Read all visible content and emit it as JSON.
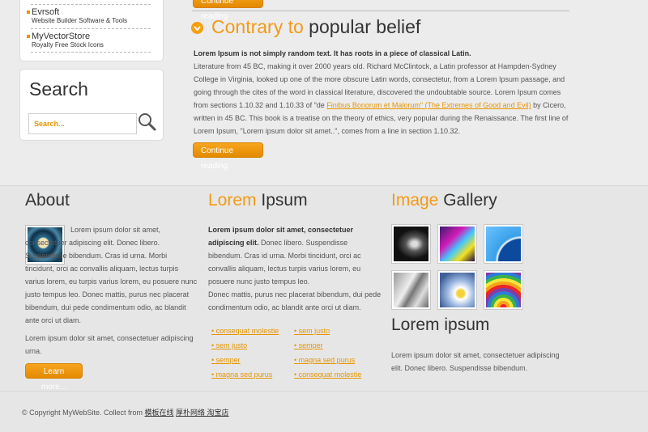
{
  "sidebar": {
    "links": [
      {
        "title": "Evrsoft",
        "desc": "Website Builder Software & Tools"
      },
      {
        "title": "MyVectorStore",
        "desc": "Royalty Free Stock Icons"
      }
    ],
    "search": {
      "title": "Search",
      "placeholder": "Search..."
    }
  },
  "article": {
    "top_button": "Continue reading",
    "title_accent": "Contrary to",
    "title_rest": "popular belief",
    "lead": "Lorem Ipsum is not simply random text. It has roots in a piece of classical Latin.",
    "body_before_link": "Literature from 45 BC, making it over 2000 years old. Richard McClintock, a Latin professor at Hampden-Sydney College in Virginia, looked up one of the more obscure Latin words, consectetur, from a Lorem Ipsum passage, and going through the cites of the word in classical literature, discovered the undoubtable source. Lorem Ipsum comes from sections 1.10.32 and 1.10.33 of \"de ",
    "link_text": "Finibus Bonorum et Malorum\" (The Extremes of Good and Evil)",
    "body_after_link": " by Cicero, written in 45 BC. This book is a treatise on the theory of ethics, very popular during the Renaissance. The first line of Lorem Ipsum, \"Lorem ipsum dolor sit amet..\", comes from a line in section 1.10.32.",
    "button": "Continue reading"
  },
  "about": {
    "title": "About",
    "para1": "Lorem ipsum dolor sit amet, consectetuer adipiscing elit. Donec libero. Suspendisse bibendum. Cras id urna. Morbi tincidunt, orci ac convallis aliquam, lectus turpis varius lorem, eu turpis varius lorem, eu posuere nunc justo tempus leo. Donec mattis, purus nec placerat bibendum, dui pede condimentum odio, ac blandit ante orci ut diam.",
    "para2": "Lorem ipsum dolor sit amet, consectetuer adipiscing urna.",
    "button": "Learn more..."
  },
  "lorem": {
    "title_accent": "Lorem",
    "title_rest": "Ipsum",
    "lead_bold": "Lorem ipsum dolor sit amet, consectetuer adipiscing elit.",
    "text1": " Donec libero. Suspendisse bibendum. Cras id urna. Morbi tincidunt, orci ac convallis aliquam, lectus turpis varius lorem, eu posuere nunc justo tempus leo.",
    "text2": "Donec mattis, purus nec placerat bibendum, dui pede condimentum odio, ac blandit ante orci ut diam.",
    "links_left": [
      "consequat molestie",
      "sem justo",
      "semper",
      "magna sed purus"
    ],
    "links_right": [
      "sem justo",
      "semper",
      "magna sed purus",
      "consequat molestie"
    ]
  },
  "gallery": {
    "title_accent": "Image",
    "title_rest": "Gallery",
    "subtitle": "Lorem ipsum",
    "text": "Lorem ipsum dolor sit amet, consectetuer adipiscing elit. Donec libero. Suspendisse bibendum."
  },
  "footer": {
    "copyright": "© Copyright MyWebSite. Collect from ",
    "link1": "模板在线",
    "link2": "厚朴网络 淘宝店"
  }
}
